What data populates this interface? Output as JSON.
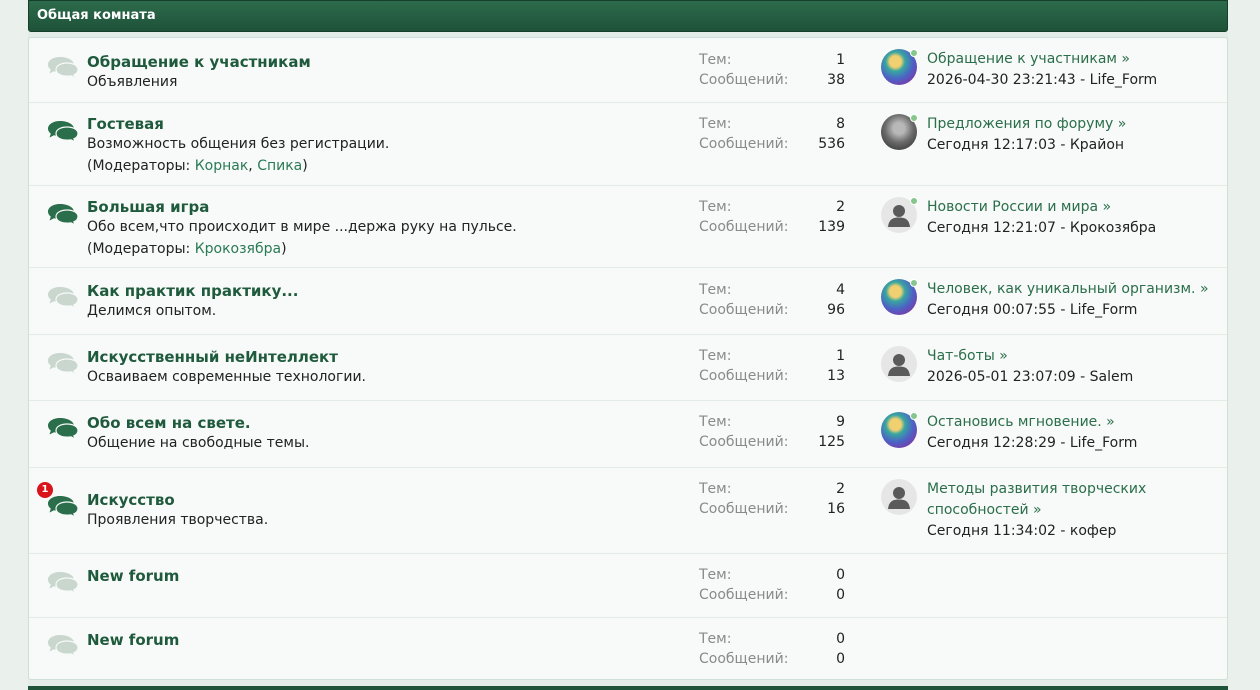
{
  "category": {
    "title": "Общая комната"
  },
  "stat_labels": {
    "topics": "Тем:",
    "posts": "Сообщений:"
  },
  "moderators_prefix": "(Модераторы:",
  "forums": [
    {
      "title": "Обращение к участникам",
      "description": "Объявления",
      "icon": "chat-bubbles-icon",
      "unread": false,
      "topics": "1",
      "posts": "38",
      "moderators": [],
      "last_post": {
        "topic": "Обращение к участникам",
        "date": "2026-04-30 23:21:43",
        "author": "Life_Form",
        "avatar": "abstract",
        "online": true
      }
    },
    {
      "title": "Гостевая",
      "description": "Возможность общения без регистрации.",
      "icon": "chat-bubbles-icon",
      "unread": true,
      "topics": "8",
      "posts": "536",
      "moderators": [
        "Корнак",
        "Спика"
      ],
      "last_post": {
        "topic": "Предложения по форуму",
        "date": "Сегодня 12:17:03",
        "author": "Крайон",
        "avatar": "gray",
        "online": true
      }
    },
    {
      "title": "Большая игра",
      "description": "Обо всем,что происходит в мире ...держа руку на пульсе.",
      "icon": "chat-bubbles-icon",
      "unread": true,
      "topics": "2",
      "posts": "139",
      "moderators": [
        "Крокозябра"
      ],
      "last_post": {
        "topic": "Новости России и мира",
        "date": "Сегодня 12:21:07",
        "author": "Крокозябра",
        "avatar": "default",
        "online": true
      }
    },
    {
      "title": "Как практик практику...",
      "description": "Делимся опытом.",
      "icon": "chat-bubbles-icon",
      "unread": false,
      "topics": "4",
      "posts": "96",
      "moderators": [],
      "last_post": {
        "topic": "Человек, как уникальный организм.",
        "date": "Сегодня 00:07:55",
        "author": "Life_Form",
        "avatar": "abstract",
        "online": true
      }
    },
    {
      "title": "Искусственный неИнтеллект",
      "description": "Осваиваем современные технологии.",
      "icon": "chat-bubbles-icon",
      "unread": false,
      "topics": "1",
      "posts": "13",
      "moderators": [],
      "last_post": {
        "topic": "Чат-боты",
        "date": "2026-05-01 23:07:09",
        "author": "Salem",
        "avatar": "default",
        "online": false
      }
    },
    {
      "title": "Обо всем на свете.",
      "description": "Общение на свободные темы.",
      "icon": "chat-bubbles-icon",
      "unread": true,
      "topics": "9",
      "posts": "125",
      "moderators": [],
      "last_post": {
        "topic": "Остановись мгновение.",
        "date": "Сегодня 12:28:29",
        "author": "Life_Form",
        "avatar": "abstract",
        "online": true
      }
    },
    {
      "title": "Искусство",
      "description": "Проявления творчества.",
      "icon": "chat-bubbles-icon",
      "unread": true,
      "badge": "1",
      "topics": "2",
      "posts": "16",
      "moderators": [],
      "last_post": {
        "topic_lines": [
          "Методы развития творческих",
          "способностей"
        ],
        "date": "Сегодня 11:34:02",
        "author": "кофер",
        "avatar": "default",
        "online": false
      }
    },
    {
      "title": "New forum",
      "description": "",
      "icon": "chat-bubbles-icon",
      "unread": false,
      "topics": "0",
      "posts": "0",
      "moderators": [],
      "last_post": null
    },
    {
      "title": "New forum",
      "description": "",
      "icon": "chat-bubbles-icon",
      "unread": false,
      "topics": "0",
      "posts": "0",
      "moderators": [],
      "last_post": null
    }
  ],
  "colors": {
    "header": "#1e5239",
    "icon_unread": "#2b6e4b",
    "icon_read": "#c9d7cf",
    "link": "#1f5a3d",
    "badge": "#d9141b"
  }
}
